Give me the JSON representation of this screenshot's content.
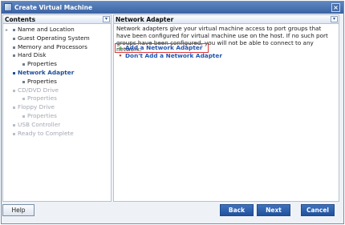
{
  "window": {
    "title": "Create Virtual Machine"
  },
  "contents": {
    "header": "Contents",
    "steps": [
      {
        "label": "Name and Location"
      },
      {
        "label": "Guest Operating System"
      },
      {
        "label": "Memory and Processors"
      },
      {
        "label": "Hard Disk"
      },
      {
        "label": "Properties"
      },
      {
        "label": "Network Adapter"
      },
      {
        "label": "Properties"
      },
      {
        "label": "CD/DVD Drive"
      },
      {
        "label": "Properties"
      },
      {
        "label": "Floppy Drive"
      },
      {
        "label": "Properties"
      },
      {
        "label": "USB Controller"
      },
      {
        "label": "Ready to Complete"
      }
    ]
  },
  "main": {
    "header": "Network Adapter",
    "description": "Network adapters give your virtual machine access to port groups that have been configured for virtual machine use on the host. If no such port groups have been configured, you will not be able to connect to any network.",
    "options": [
      {
        "icon": "add-icon",
        "label": "Add a Network Adapter"
      },
      {
        "icon": "remove-icon",
        "label": "Don't Add a Network Adapter"
      }
    ]
  },
  "buttons": {
    "help": "Help",
    "back": "Back",
    "next": "Next",
    "cancel": "Cancel"
  },
  "colors": {
    "title_bar": "#3a63a3",
    "link": "#1f56b0",
    "selection_box": "#d93a3a",
    "primary_button": "#20519b"
  }
}
